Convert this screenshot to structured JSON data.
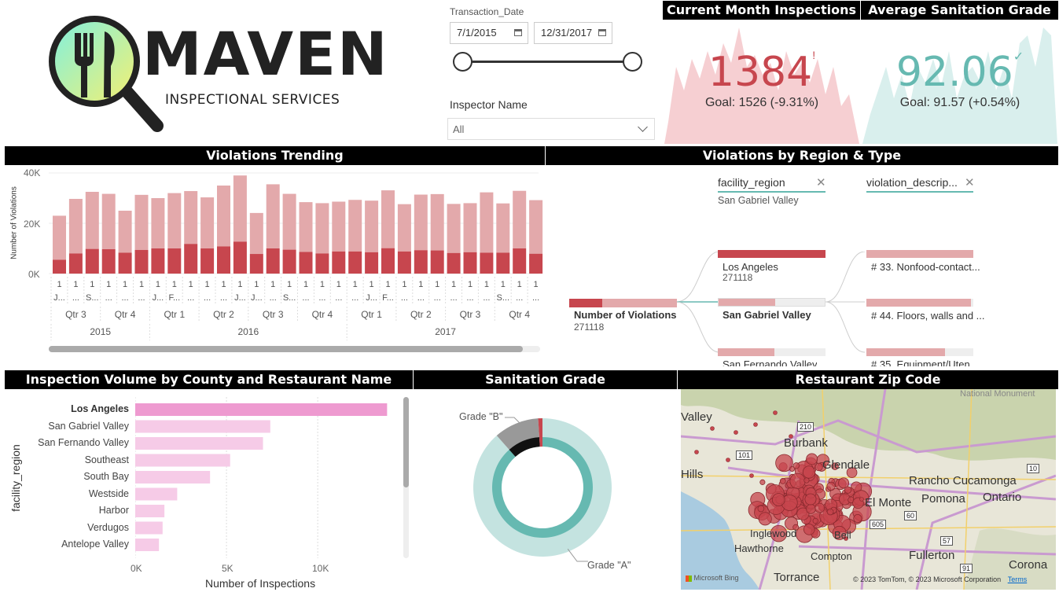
{
  "logo": {
    "brand": "MAVEN",
    "tagline": "INSPECTIONAL SERVICES"
  },
  "filters": {
    "date_label": "Transaction_Date",
    "start_date": "7/1/2015",
    "end_date": "12/31/2017",
    "inspector_label": "Inspector Name",
    "inspector_value": "All"
  },
  "kpi_inspections": {
    "title": "Current Month Inspections",
    "value": "1384",
    "status_glyph": "!",
    "goal": "Goal: 1526 (-9.31%)",
    "color": "#c7464e"
  },
  "kpi_grade": {
    "title": "Average Sanitation Grade",
    "value": "92.06",
    "status_glyph": "✓",
    "goal": "Goal: 91.57 (+0.54%)",
    "color": "#6cb9b2"
  },
  "trend": {
    "title": "Violations Trending",
    "ylabel": "Number of Violations",
    "yticks": [
      "40K",
      "20K",
      "0K"
    ],
    "month_row1": [
      "1",
      "1",
      "1",
      "1",
      "1",
      "1",
      "1",
      "1",
      "1",
      "1",
      "1",
      "1",
      "1",
      "1",
      "1",
      "1",
      "1",
      "1",
      "1",
      "1",
      "1",
      "1",
      "1",
      "1",
      "1",
      "1",
      "1",
      "1",
      "1",
      "1"
    ],
    "month_row2": [
      "J...",
      "...",
      "S...",
      "...",
      "...",
      "...",
      "J...",
      "F...",
      "...",
      "...",
      "...",
      "J...",
      "J...",
      "...",
      "S...",
      "...",
      "...",
      "...",
      "...",
      "J...",
      "F...",
      "...",
      "...",
      "...",
      "...",
      "...",
      "...",
      "S...",
      "...",
      "..."
    ],
    "quarters": [
      "Qtr 3",
      "Qtr 4",
      "Qtr 1",
      "Qtr 2",
      "Qtr 3",
      "Qtr 4",
      "Qtr 1",
      "Qtr 2",
      "Qtr 3",
      "Qtr 4"
    ],
    "years": [
      "2015",
      "2016",
      "2017"
    ]
  },
  "chart_data": [
    {
      "type": "bar",
      "title": "Violations Trending",
      "ylabel": "Number of Violations",
      "ylim": [
        0,
        40000
      ],
      "stacked": true,
      "categories": [
        "2015-07",
        "2015-08",
        "2015-09",
        "2015-10",
        "2015-11",
        "2015-12",
        "2016-01",
        "2016-02",
        "2016-03",
        "2016-04",
        "2016-05",
        "2016-06",
        "2016-07",
        "2016-08",
        "2016-09",
        "2016-10",
        "2016-11",
        "2016-12",
        "2017-01",
        "2017-02",
        "2017-03",
        "2017-04",
        "2017-05",
        "2017-06",
        "2017-07",
        "2017-08",
        "2017-09",
        "2017-10",
        "2017-11",
        "2017-12"
      ],
      "series": [
        {
          "values": [
            5500,
            8000,
            9800,
            9700,
            8300,
            9400,
            10000,
            10000,
            11800,
            10000,
            10800,
            12700,
            7800,
            10000,
            9500,
            8600,
            8000,
            8800,
            8800,
            8500,
            10100,
            8800,
            9300,
            9200,
            8200,
            8500,
            8300,
            8300,
            10000,
            7900
          ]
        },
        {
          "values": [
            17500,
            21700,
            22700,
            22000,
            16700,
            21900,
            20000,
            22000,
            21000,
            20300,
            24200,
            26300,
            16300,
            25500,
            22200,
            19800,
            20000,
            19800,
            20500,
            20500,
            23000,
            18800,
            22100,
            22400,
            19500,
            19500,
            24000,
            19600,
            22900,
            21300
          ]
        }
      ]
    },
    {
      "type": "bar",
      "title": "Inspection Volume by County and Restaurant Name",
      "ylabel": "facility_region",
      "xlabel": "Number of Inspections",
      "ticks": [
        "0K",
        "5K",
        "10K"
      ],
      "xlim": [
        0,
        14000
      ],
      "categories": [
        "Los Angeles",
        "San Gabriel Valley",
        "San Fernando Valley",
        "Southeast",
        "South Bay",
        "Westside",
        "Harbor",
        "Verdugos",
        "Antelope Valley"
      ],
      "values": [
        13800,
        7400,
        7000,
        5200,
        4100,
        2300,
        1600,
        1500,
        1300
      ]
    },
    {
      "type": "pie",
      "title": "Sanitation Grade",
      "categories": [
        "Grade \"A\"",
        "Grade \"B\"",
        "Grade \"C\""
      ],
      "values": [
        88.5,
        10.5,
        1.0
      ]
    }
  ],
  "decomp": {
    "title": "Violations by Region & Type",
    "root_label": "Number of Violations",
    "root_value": "271118",
    "col1_header": "facility_region",
    "col1_filter": "San Gabriel Valley",
    "col1_items": [
      {
        "label": "Los Angeles",
        "value": "271118"
      },
      {
        "label": "San Gabriel Valley",
        "value": ""
      },
      {
        "label": "San Fernando Valley",
        "value": ""
      }
    ],
    "col2_header": "violation_descrip...",
    "col2_items": [
      "# 33. Nonfood-contact...",
      "# 44. Floors, walls and ...",
      "# 35. Equipment/Uten..."
    ]
  },
  "hbar": {
    "title": "Inspection Volume by County and Restaurant Name",
    "ylabel": "facility_region",
    "xlabel": "Number of Inspections",
    "labels": [
      "Los Angeles",
      "San Gabriel Valley",
      "San Fernando Valley",
      "Southeast",
      "South Bay",
      "Westside",
      "Harbor",
      "Verdugos",
      "Antelope Valley"
    ],
    "ticks": [
      "0K",
      "5K",
      "10K"
    ]
  },
  "donut": {
    "title": "Sanitation Grade",
    "label_b": "Grade \"B\"",
    "label_a": "Grade \"A\"",
    "colors": {
      "a": "#66b9b1",
      "a_light": "#c4e3e0",
      "b": "#111111",
      "b_light": "#999999",
      "c": "#c7464e"
    }
  },
  "map": {
    "title": "Restaurant Zip Code",
    "places": [
      "Valley",
      "Burbank",
      "Glendale",
      "Rancho Cucamonga",
      "El Monte",
      "Pomona",
      "Ontario",
      "Hawthorne",
      "Inglewood",
      "Bell",
      "Compton",
      "Fullerton",
      "Torrance",
      "Corona",
      "Hills",
      "National Monument"
    ],
    "highways": [
      "210",
      "101",
      "605",
      "60",
      "57",
      "91",
      "10"
    ],
    "attribution": "© 2023 TomTom, © 2023 Microsoft Corporation",
    "terms": "Terms",
    "bing": "Microsoft Bing"
  },
  "colors": {
    "accent": "#c7464e",
    "accent_light": "#e3a9ab",
    "pink": "#ee9ad0",
    "pink_light": "#f6cbe7",
    "teal": "#66b9b1"
  }
}
